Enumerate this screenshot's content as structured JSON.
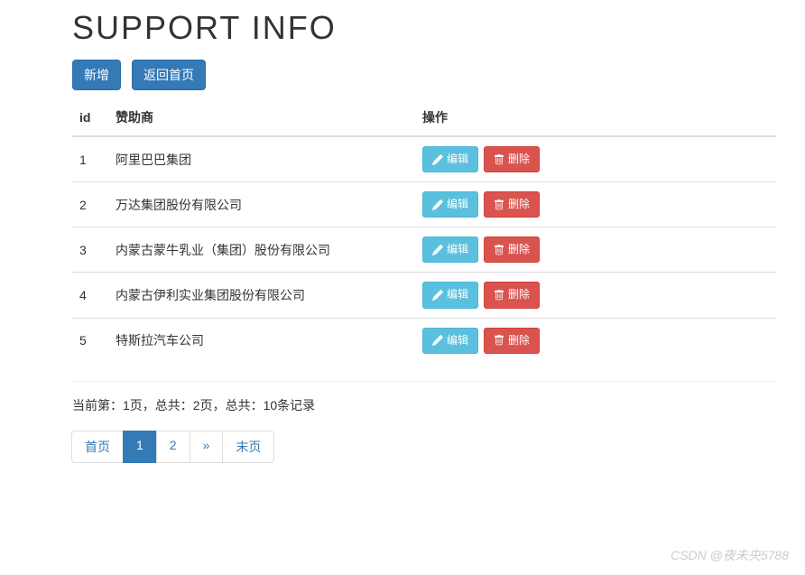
{
  "title": "SUPPORT INFO",
  "toolbar": {
    "add_label": "新增",
    "back_label": "返回首页"
  },
  "table": {
    "headers": {
      "id": "id",
      "sponsor": "赞助商",
      "actions": "操作"
    },
    "action_labels": {
      "edit": "编辑",
      "delete": "删除"
    },
    "rows": [
      {
        "id": "1",
        "sponsor": "阿里巴巴集团"
      },
      {
        "id": "2",
        "sponsor": "万达集团股份有限公司"
      },
      {
        "id": "3",
        "sponsor": "内蒙古蒙牛乳业（集团）股份有限公司"
      },
      {
        "id": "4",
        "sponsor": "内蒙古伊利实业集团股份有限公司"
      },
      {
        "id": "5",
        "sponsor": "特斯拉汽车公司"
      }
    ]
  },
  "pagination": {
    "info": "当前第：1页，总共：2页，总共：10条记录",
    "first_label": "首页",
    "pages": [
      "1",
      "2"
    ],
    "next_symbol": "»",
    "last_label": "末页",
    "active": "1"
  },
  "watermark": "CSDN @夜未央5788"
}
